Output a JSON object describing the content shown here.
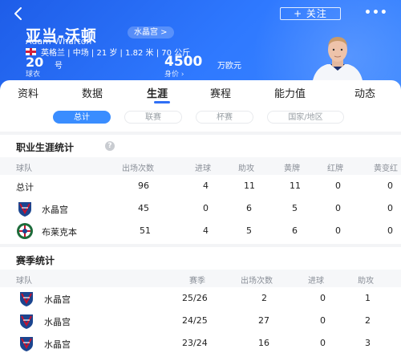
{
  "header": {
    "follow_label": "+ 关注",
    "name_cn": "亚当-沃顿",
    "name_en": "Adam Wharton",
    "team_tag": "水晶宫 >",
    "info": "英格兰 | 中场 | 21 岁 | 1.82 米 | 70 公斤",
    "jersey_number": "20",
    "jersey_unit": "号",
    "jersey_label": "球衣",
    "market_value": "4500",
    "market_value_unit": "万欧元",
    "market_value_label": "身价 ›"
  },
  "tabs": [
    "资料",
    "数据",
    "生涯",
    "赛程",
    "能力值",
    "动态"
  ],
  "active_tab": "生涯",
  "filters": [
    "总计",
    "联赛",
    "杯赛",
    "国家/地区"
  ],
  "active_filter": "总计",
  "career": {
    "title": "职业生涯统计",
    "columns": [
      "球队",
      "出场次数",
      "进球",
      "助攻",
      "黄牌",
      "红牌",
      "黄变红"
    ],
    "rows": [
      {
        "team": "总计",
        "logo": "",
        "apps": "96",
        "goals": "4",
        "assists": "11",
        "yellow": "11",
        "red": "0",
        "yellow_red": "0"
      },
      {
        "team": "水晶宫",
        "logo": "crystal-palace-logo",
        "apps": "45",
        "goals": "0",
        "assists": "6",
        "yellow": "5",
        "red": "0",
        "yellow_red": "0"
      },
      {
        "team": "布莱克本",
        "logo": "blackburn-logo",
        "apps": "51",
        "goals": "4",
        "assists": "5",
        "yellow": "6",
        "red": "0",
        "yellow_red": "0"
      }
    ]
  },
  "season": {
    "title": "赛季统计",
    "columns": [
      "球队",
      "赛季",
      "出场次数",
      "进球",
      "助攻"
    ],
    "rows": [
      {
        "team": "水晶宫",
        "logo": "crystal-palace-logo",
        "season": "25/26",
        "apps": "2",
        "goals": "0",
        "assists": "1"
      },
      {
        "team": "水晶宫",
        "logo": "crystal-palace-logo",
        "season": "24/25",
        "apps": "27",
        "goals": "0",
        "assists": "2"
      },
      {
        "team": "水晶宫",
        "logo": "crystal-palace-logo",
        "season": "23/24",
        "apps": "16",
        "goals": "0",
        "assists": "3"
      }
    ]
  },
  "colors": {
    "brand_blue": "#2f6ff5",
    "header_gradient_start": "#1e5de8",
    "pill_active": "#3a8dff"
  }
}
